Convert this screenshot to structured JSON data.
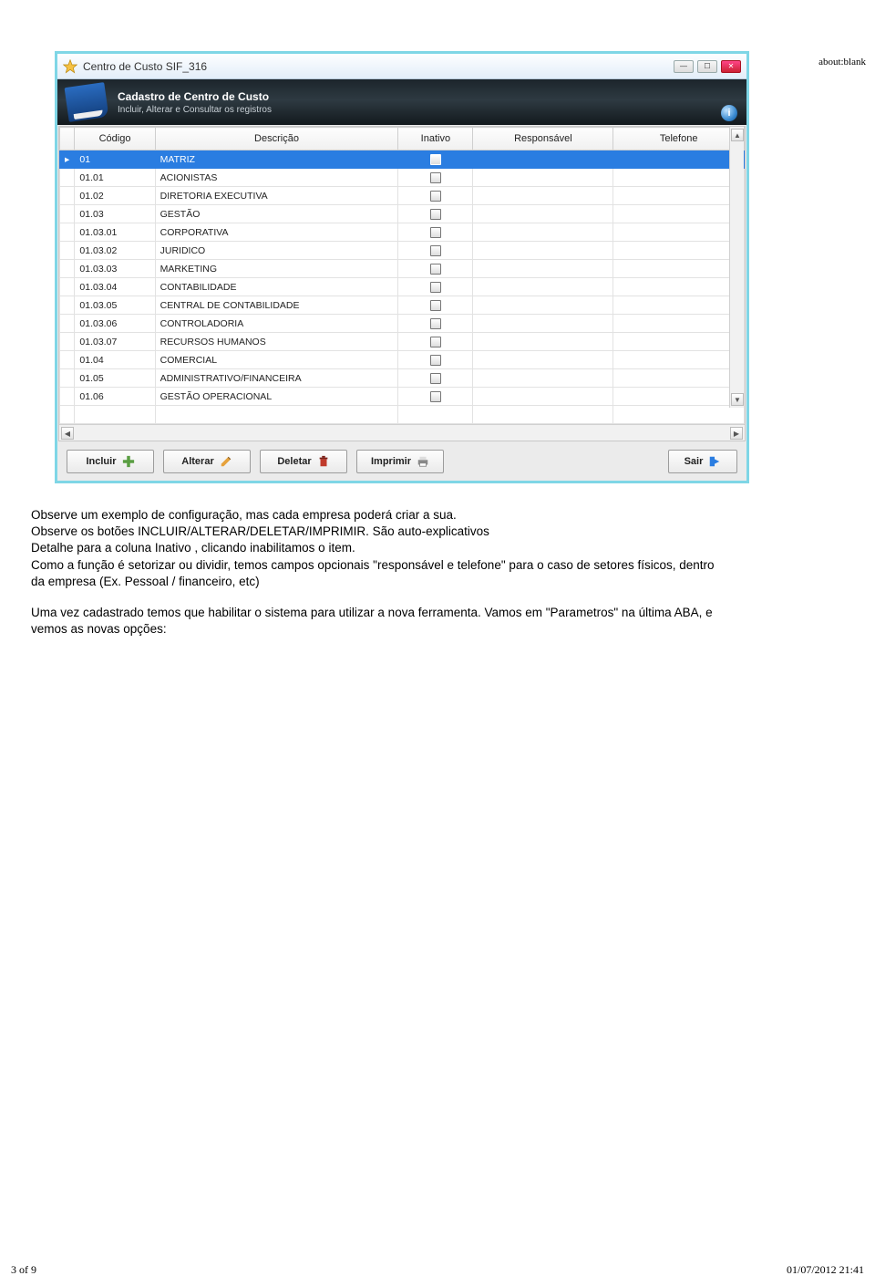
{
  "page": {
    "url": "about:blank",
    "footer_left": "3 of 9",
    "footer_right": "01/07/2012 21:41"
  },
  "window": {
    "title": "Centro de Custo  SIF_316",
    "banner_title": "Cadastro de Centro de Custo",
    "banner_subtitle": "Incluir, Alterar e Consultar os registros"
  },
  "columns": {
    "c0": "",
    "c1": "Código",
    "c2": "Descrição",
    "c3": "Inativo",
    "c4": "Responsável",
    "c5": "Telefone"
  },
  "rows": [
    {
      "code": "01",
      "desc": "MATRIZ",
      "selected": true
    },
    {
      "code": "01.01",
      "desc": "ACIONISTAS",
      "selected": false
    },
    {
      "code": "01.02",
      "desc": "DIRETORIA EXECUTIVA",
      "selected": false
    },
    {
      "code": "01.03",
      "desc": "GESTÃO",
      "selected": false
    },
    {
      "code": "01.03.01",
      "desc": "CORPORATIVA",
      "selected": false
    },
    {
      "code": "01.03.02",
      "desc": "JURIDICO",
      "selected": false
    },
    {
      "code": "01.03.03",
      "desc": "MARKETING",
      "selected": false
    },
    {
      "code": "01.03.04",
      "desc": "CONTABILIDADE",
      "selected": false
    },
    {
      "code": "01.03.05",
      "desc": "CENTRAL DE CONTABILIDADE",
      "selected": false
    },
    {
      "code": "01.03.06",
      "desc": "CONTROLADORIA",
      "selected": false
    },
    {
      "code": "01.03.07",
      "desc": "RECURSOS HUMANOS",
      "selected": false
    },
    {
      "code": "01.04",
      "desc": "COMERCIAL",
      "selected": false
    },
    {
      "code": "01.05",
      "desc": "ADMINISTRATIVO/FINANCEIRA",
      "selected": false
    },
    {
      "code": "01.06",
      "desc": "GESTÃO OPERACIONAL",
      "selected": false
    }
  ],
  "buttons": {
    "incluir": "Incluir",
    "alterar": "Alterar",
    "deletar": "Deletar",
    "imprimir": "Imprimir",
    "sair": "Sair"
  },
  "text": {
    "p1a": "Observe um exemplo de configuração, mas cada empresa poderá criar a sua.",
    "p1b": "Observe os botões INCLUIR/ALTERAR/DELETAR/IMPRIMIR. São auto-explicativos",
    "p1c": "Detalhe para a coluna Inativo , clicando inabilitamos o item.",
    "p1d": "Como a função é setorizar ou dividir, temos campos opcionais \"responsável e telefone\" para o caso de setores físicos, dentro",
    "p1e": "da empresa (Ex. Pessoal / financeiro, etc)",
    "p2a": "Uma vez cadastrado temos que habilitar o sistema para utilizar a nova ferramenta. Vamos em \"Parametros\" na última ABA, e",
    "p2b": "vemos as novas opções:"
  }
}
